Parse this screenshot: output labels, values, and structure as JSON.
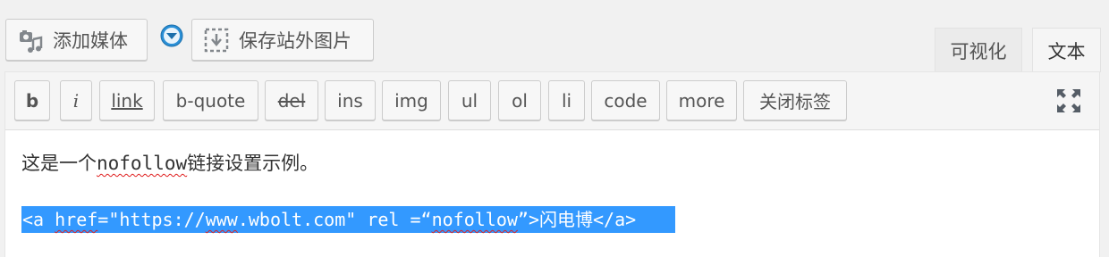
{
  "media_buttons": {
    "add_media_label": "添加媒体",
    "add_media_icon": "camera-music-icon",
    "download_icon": "download-arrow-icon",
    "save_external_label": "保存站外图片",
    "save_external_icon": "dashed-download-box-icon"
  },
  "tabs": {
    "visual_label": "可视化",
    "text_label": "文本",
    "active": "text"
  },
  "quicktags": {
    "b": "b",
    "i": "i",
    "link": "link",
    "b_quote": "b-quote",
    "del": "del",
    "ins": "ins",
    "img": "img",
    "ul": "ul",
    "ol": "ol",
    "li": "li",
    "code": "code",
    "more": "more",
    "close_tags": "关闭标签",
    "fullscreen_icon": "fullscreen-expand-icon"
  },
  "content": {
    "line1_prefix": "这是一个",
    "line1_word": "nofollow",
    "line1_suffix": "链接设置示例。",
    "line2_open": "<a ",
    "line2_href": "href",
    "line2_url_prefix": "=\"https://",
    "line2_url_www": "www",
    "line2_url_rest": ".wbolt.com\" rel =“",
    "line2_rel": "nofollow",
    "line2_close": "”>",
    "line2_anchor": "闪电博",
    "line2_end": "</a>"
  },
  "colors": {
    "selection": "#3399ff",
    "spellcheck": "#e02020",
    "download_icon": "#2a8fd6"
  }
}
